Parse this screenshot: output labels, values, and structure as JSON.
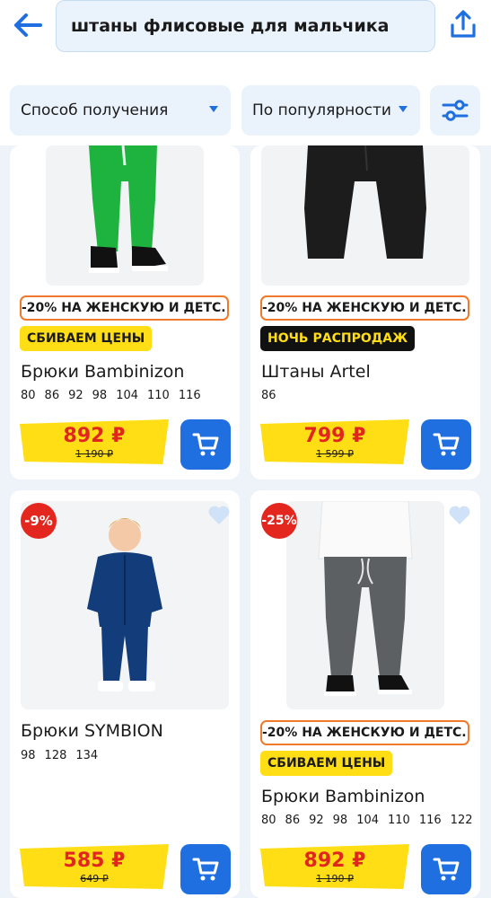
{
  "search": {
    "query": "штаны флисовые для мальчика"
  },
  "filters": {
    "delivery_label": "Способ получения",
    "sort_label": "По популярности"
  },
  "colors": {
    "accent": "#1f6fe0",
    "price_tag": "#ffde15",
    "price_text": "#e0261e",
    "promo_border": "#f07a2b",
    "discount_badge": "#e3261e"
  },
  "products": [
    {
      "promo": "-20% НА ЖЕНСКУЮ И ДЕТС...",
      "badge": "СБИВАЕМ ЦЕНЫ",
      "title": "Брюки Bambinizon",
      "sizes": [
        "80",
        "86",
        "92",
        "98",
        "104",
        "110",
        "116"
      ],
      "price": "892 ₽",
      "old_price": "1 190 ₽"
    },
    {
      "promo": "-20% НА ЖЕНСКУЮ И ДЕТС...",
      "badge": "НОЧЬ РАСПРОДАЖ",
      "title": "Штаны Artel",
      "sizes": [
        "86"
      ],
      "price": "799 ₽",
      "old_price": "1 599 ₽"
    },
    {
      "discount": "-9%",
      "title": "Брюки SYMBION",
      "sizes": [
        "98",
        "128",
        "134"
      ],
      "price": "585 ₽",
      "old_price": "649 ₽"
    },
    {
      "discount": "-25%",
      "promo": "-20% НА ЖЕНСКУЮ И ДЕТС...",
      "badge": "СБИВАЕМ ЦЕНЫ",
      "title": "Брюки Bambinizon",
      "sizes": [
        "80",
        "86",
        "92",
        "98",
        "104",
        "110",
        "116",
        "122"
      ],
      "price": "892 ₽",
      "old_price": "1 190 ₽"
    }
  ]
}
